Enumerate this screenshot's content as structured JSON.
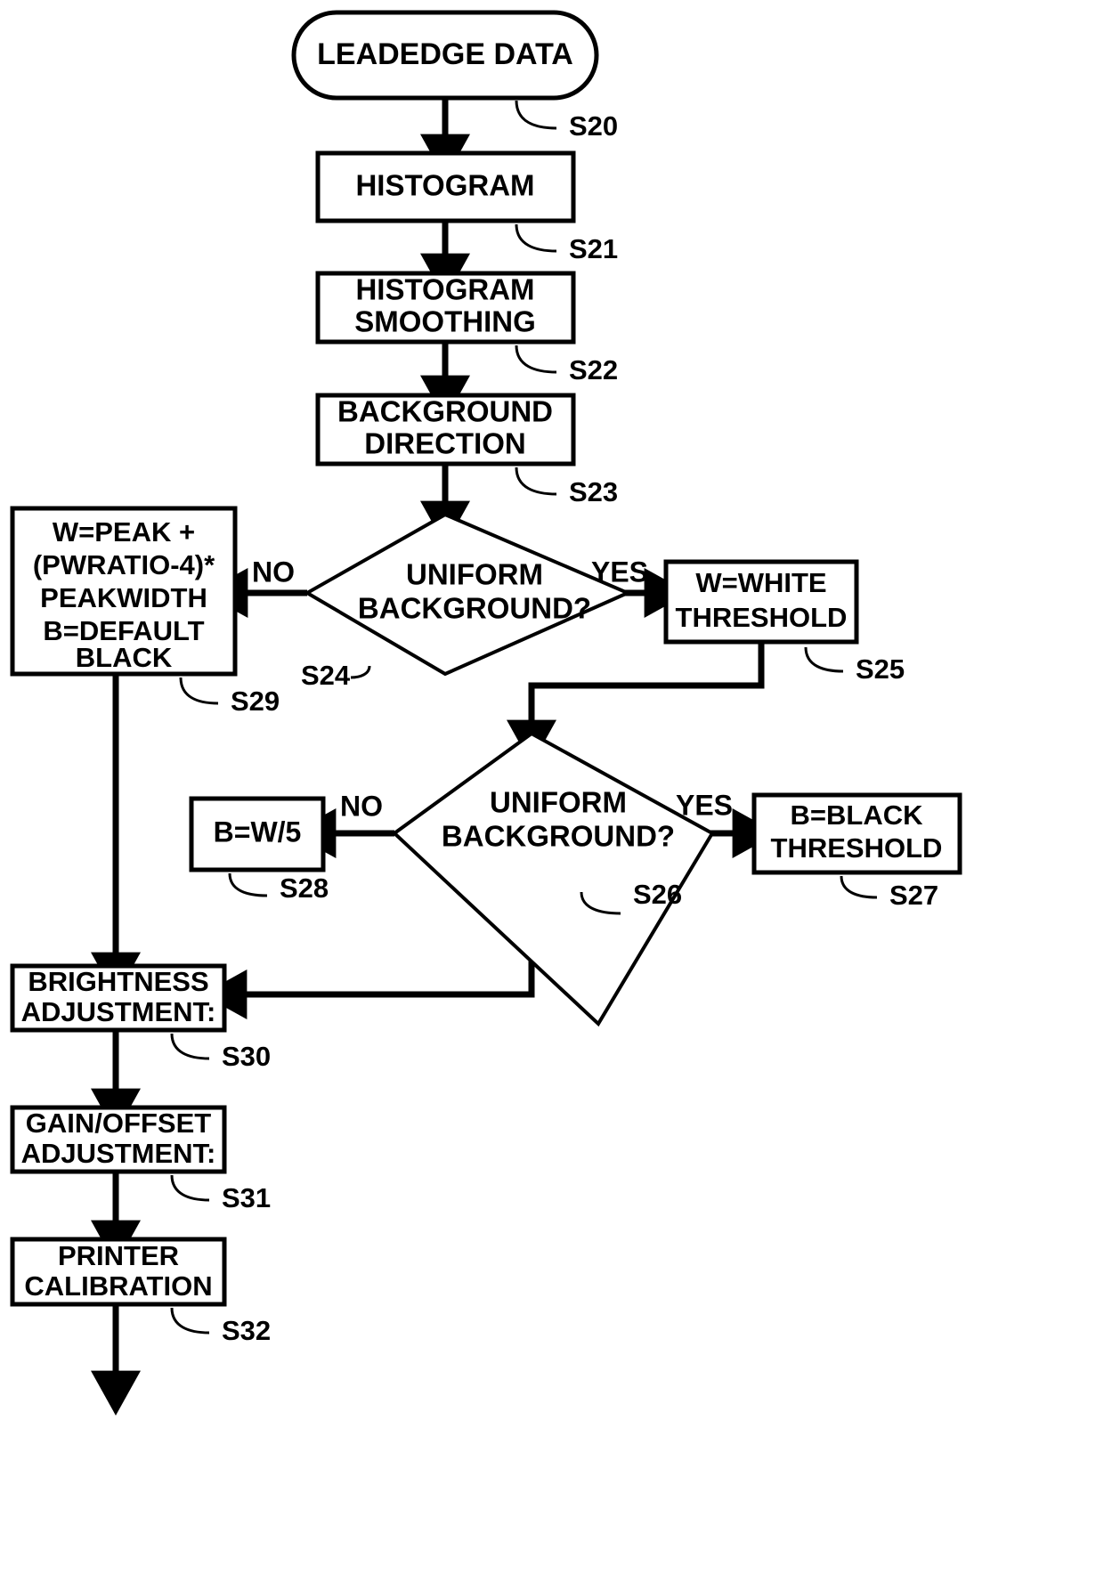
{
  "diagram": {
    "title": "Leadedge Data Processing Flowchart",
    "type": "flowchart",
    "colors": {
      "stroke": "#000000",
      "fill": "#ffffff",
      "background": "#ffffff"
    },
    "nodes": [
      {
        "id": "n20",
        "ref": "S20",
        "shape": "terminal",
        "lines": [
          "LEADEDGE DATA"
        ]
      },
      {
        "id": "n21",
        "ref": "S21",
        "shape": "process",
        "lines": [
          "HISTOGRAM"
        ]
      },
      {
        "id": "n22",
        "ref": "S22",
        "shape": "process",
        "lines": [
          "HISTOGRAM",
          "SMOOTHING"
        ]
      },
      {
        "id": "n23",
        "ref": "S23",
        "shape": "process",
        "lines": [
          "BACKGROUND",
          "DIRECTION"
        ]
      },
      {
        "id": "n24",
        "ref": "S24",
        "shape": "decision",
        "lines": [
          "UNIFORM",
          "BACKGROUND?"
        ]
      },
      {
        "id": "n25",
        "ref": "S25",
        "shape": "process",
        "lines": [
          "W=WHITE",
          "THRESHOLD"
        ]
      },
      {
        "id": "n26",
        "ref": "S26",
        "shape": "decision",
        "lines": [
          "UNIFORM",
          "BACKGROUND?"
        ]
      },
      {
        "id": "n27",
        "ref": "S27",
        "shape": "process",
        "lines": [
          "B=BLACK",
          "THRESHOLD"
        ]
      },
      {
        "id": "n28",
        "ref": "S28",
        "shape": "process",
        "lines": [
          "B=W/5"
        ]
      },
      {
        "id": "n29",
        "ref": "S29",
        "shape": "process",
        "lines": [
          "W=PEAK +",
          "(PWRATIO-4)*",
          "PEAKWIDTH",
          "B=DEFAULT",
          "BLACK"
        ]
      },
      {
        "id": "n30",
        "ref": "S30",
        "shape": "process",
        "lines": [
          "BRIGHTNESS",
          "ADJUSTMENT:"
        ]
      },
      {
        "id": "n31",
        "ref": "S31",
        "shape": "process",
        "lines": [
          "GAIN/OFFSET",
          "ADJUSTMENT:"
        ]
      },
      {
        "id": "n32",
        "ref": "S32",
        "shape": "process",
        "lines": [
          "PRINTER",
          "CALIBRATION"
        ]
      }
    ],
    "branch_labels": {
      "d24_no": "NO",
      "d24_yes": "YES",
      "d26_no": "NO",
      "d26_yes": "YES"
    },
    "edges": [
      {
        "from": "S20",
        "to": "S21",
        "label": ""
      },
      {
        "from": "S21",
        "to": "S22",
        "label": ""
      },
      {
        "from": "S22",
        "to": "S23",
        "label": ""
      },
      {
        "from": "S23",
        "to": "S24",
        "label": ""
      },
      {
        "from": "S24",
        "to": "S29",
        "label": "NO"
      },
      {
        "from": "S24",
        "to": "S25",
        "label": "YES"
      },
      {
        "from": "S25",
        "to": "S26",
        "label": ""
      },
      {
        "from": "S26",
        "to": "S28",
        "label": "NO"
      },
      {
        "from": "S26",
        "to": "S27",
        "label": "YES"
      },
      {
        "from": "S26",
        "to": "S30",
        "label": ""
      },
      {
        "from": "S29",
        "to": "S30",
        "label": ""
      },
      {
        "from": "S30",
        "to": "S31",
        "label": ""
      },
      {
        "from": "S31",
        "to": "S32",
        "label": ""
      },
      {
        "from": "S32",
        "to": "",
        "label": ""
      }
    ]
  }
}
